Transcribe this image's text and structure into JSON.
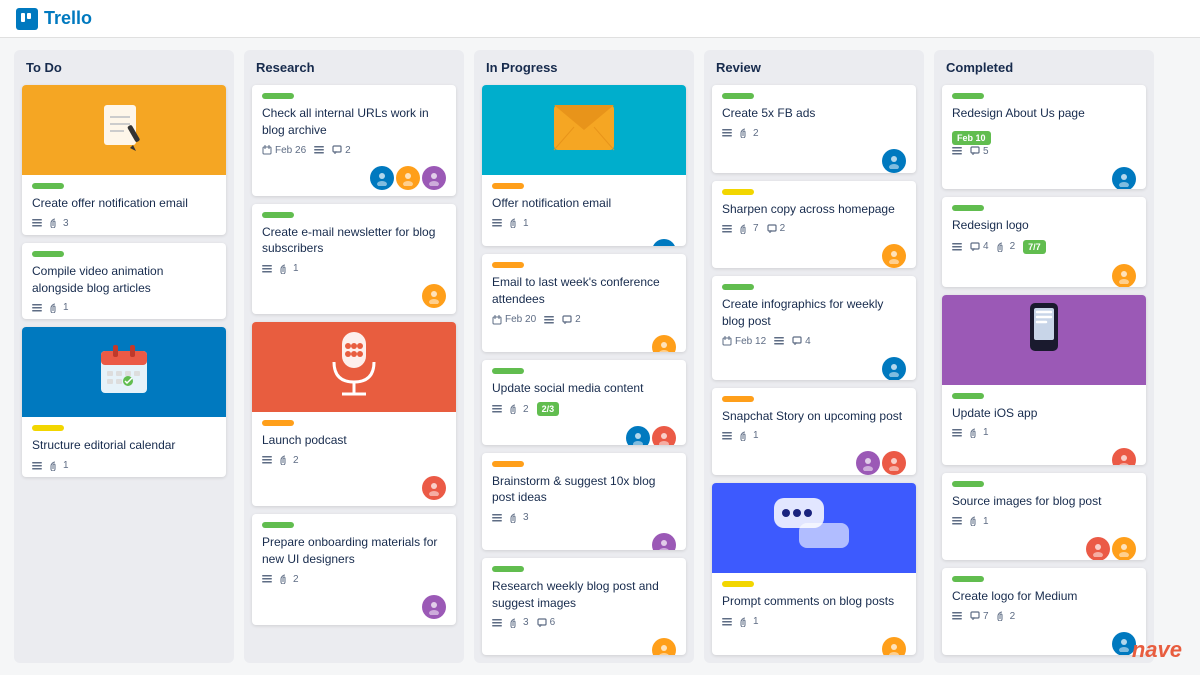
{
  "app": {
    "logo_text": "Trello",
    "nave_text": "nave"
  },
  "columns": [
    {
      "id": "todo",
      "title": "To Do",
      "cards": [
        {
          "id": "todo-1",
          "image_type": "yellow",
          "image_content": "note",
          "label_color": "green",
          "title": "Create offer notification email",
          "meta": [
            {
              "icon": "lines"
            },
            {
              "icon": "paperclip",
              "count": "3"
            }
          ],
          "avatars": []
        },
        {
          "id": "todo-2",
          "image_type": null,
          "image_content": null,
          "label_color": "green",
          "title": "Compile video animation alongside blog articles",
          "meta": [
            {
              "icon": "lines"
            },
            {
              "icon": "paperclip",
              "count": "1"
            }
          ],
          "avatars": []
        },
        {
          "id": "todo-3",
          "image_type": "blue",
          "image_content": "calendar",
          "label_color": "yellow",
          "title": "Structure editorial calendar",
          "meta": [
            {
              "icon": "lines"
            },
            {
              "icon": "paperclip",
              "count": "1"
            }
          ],
          "avatars": []
        }
      ]
    },
    {
      "id": "research",
      "title": "Research",
      "cards": [
        {
          "id": "research-1",
          "image_type": null,
          "image_content": null,
          "label_color": "green",
          "title": "Check all internal URLs work in blog archive",
          "meta": [
            {
              "icon": "date",
              "text": "Feb 26"
            },
            {
              "icon": "lines"
            },
            {
              "icon": "comment",
              "count": "2"
            }
          ],
          "avatars": [
            "blue",
            "orange",
            "purple"
          ]
        },
        {
          "id": "research-2",
          "image_type": null,
          "image_content": null,
          "label_color": "green",
          "title": "Create e-mail newsletter for blog subscribers",
          "meta": [
            {
              "icon": "lines"
            },
            {
              "icon": "paperclip",
              "count": "1"
            }
          ],
          "avatars": [
            "orange"
          ]
        },
        {
          "id": "research-3",
          "image_type": "orange",
          "image_content": "mic",
          "label_color": "orange",
          "title": "Launch podcast",
          "meta": [
            {
              "icon": "lines"
            },
            {
              "icon": "paperclip",
              "count": "2"
            }
          ],
          "avatars": [
            "red"
          ]
        },
        {
          "id": "research-4",
          "image_type": null,
          "image_content": null,
          "label_color": "green",
          "title": "Prepare onboarding materials for new UI designers",
          "meta": [
            {
              "icon": "lines"
            },
            {
              "icon": "paperclip",
              "count": "2"
            }
          ],
          "avatars": [
            "purple"
          ]
        }
      ]
    },
    {
      "id": "inprogress",
      "title": "In Progress",
      "cards": [
        {
          "id": "ip-1",
          "image_type": "green",
          "image_content": "envelope",
          "label_color": "orange",
          "title": "Offer notification email",
          "meta": [
            {
              "icon": "lines"
            },
            {
              "icon": "paperclip",
              "count": "1"
            }
          ],
          "avatars": [
            "blue"
          ]
        },
        {
          "id": "ip-2",
          "image_type": null,
          "image_content": null,
          "label_color": "orange",
          "title": "Email to last week's conference attendees",
          "meta": [
            {
              "icon": "date",
              "text": "Feb 20"
            },
            {
              "icon": "lines"
            },
            {
              "icon": "comment",
              "count": "2"
            }
          ],
          "avatars": [
            "orange"
          ]
        },
        {
          "id": "ip-3",
          "image_type": null,
          "image_content": null,
          "label_color": "green",
          "title": "Update social media content",
          "meta": [
            {
              "icon": "lines"
            },
            {
              "icon": "paperclip",
              "count": "2"
            },
            {
              "icon": "progress",
              "text": "2/3"
            }
          ],
          "avatars": [
            "blue",
            "red"
          ]
        },
        {
          "id": "ip-4",
          "image_type": null,
          "image_content": null,
          "label_color": "orange",
          "title": "Brainstorm & suggest 10x blog post ideas",
          "meta": [
            {
              "icon": "lines"
            },
            {
              "icon": "paperclip",
              "count": "3"
            }
          ],
          "avatars": [
            "purple"
          ]
        },
        {
          "id": "ip-5",
          "image_type": null,
          "image_content": null,
          "label_color": "green",
          "title": "Research weekly blog post and suggest images",
          "meta": [
            {
              "icon": "lines"
            },
            {
              "icon": "paperclip",
              "count": "3"
            },
            {
              "icon": "comment",
              "count": "6"
            }
          ],
          "avatars": [
            "orange"
          ]
        }
      ]
    },
    {
      "id": "review",
      "title": "Review",
      "cards": [
        {
          "id": "rev-1",
          "image_type": null,
          "image_content": null,
          "label_color": "green",
          "title": "Create 5x FB ads",
          "meta": [
            {
              "icon": "lines"
            },
            {
              "icon": "paperclip",
              "count": "2"
            }
          ],
          "avatars": [
            "blue"
          ]
        },
        {
          "id": "rev-2",
          "image_type": null,
          "image_content": null,
          "label_color": "yellow",
          "title": "Sharpen copy across homepage",
          "meta": [
            {
              "icon": "lines"
            },
            {
              "icon": "paperclip",
              "count": "7"
            },
            {
              "icon": "comment",
              "count": "2"
            }
          ],
          "avatars": [
            "orange"
          ]
        },
        {
          "id": "rev-3",
          "image_type": null,
          "image_content": null,
          "label_color": "green",
          "title": "Create infographics for weekly blog post",
          "meta": [
            {
              "icon": "date",
              "text": "Feb 12"
            },
            {
              "icon": "lines"
            },
            {
              "icon": "comment",
              "count": "4"
            }
          ],
          "avatars": [
            "blue"
          ]
        },
        {
          "id": "rev-4",
          "image_type": null,
          "image_content": null,
          "label_color": "orange",
          "title": "Snapchat Story on upcoming post",
          "meta": [
            {
              "icon": "lines"
            },
            {
              "icon": "paperclip",
              "count": "1"
            }
          ],
          "avatars": [
            "purple",
            "red"
          ]
        },
        {
          "id": "rev-5",
          "image_type": "blue2",
          "image_content": "chat",
          "label_color": "yellow",
          "title": "Prompt comments on blog posts",
          "meta": [
            {
              "icon": "lines"
            },
            {
              "icon": "paperclip",
              "count": "1"
            }
          ],
          "avatars": [
            "orange"
          ]
        }
      ]
    },
    {
      "id": "completed",
      "title": "Completed",
      "cards": [
        {
          "id": "comp-1",
          "image_type": null,
          "image_content": null,
          "label_color": "green",
          "title": "Redesign About Us page",
          "meta_date": "Feb 10",
          "meta": [
            {
              "icon": "lines"
            },
            {
              "icon": "comment",
              "count": "5"
            }
          ],
          "avatars": [
            "blue"
          ]
        },
        {
          "id": "comp-2",
          "image_type": null,
          "image_content": null,
          "label_color": "green",
          "title": "Redesign logo",
          "meta": [
            {
              "icon": "lines"
            },
            {
              "icon": "comment",
              "count": "4"
            },
            {
              "icon": "paperclip",
              "count": "2"
            },
            {
              "icon": "progress",
              "text": "7/7"
            }
          ],
          "avatars": [
            "orange"
          ]
        },
        {
          "id": "comp-3",
          "image_type": "purple",
          "image_content": "phone",
          "label_color": "green",
          "title": "Update iOS app",
          "meta": [
            {
              "icon": "lines"
            },
            {
              "icon": "paperclip",
              "count": "1"
            }
          ],
          "avatars": [
            "red"
          ]
        },
        {
          "id": "comp-4",
          "image_type": null,
          "image_content": null,
          "label_color": "green",
          "title": "Source images for blog post",
          "meta": [
            {
              "icon": "lines"
            },
            {
              "icon": "paperclip",
              "count": "1"
            }
          ],
          "avatars": [
            "red",
            "orange"
          ]
        },
        {
          "id": "comp-5",
          "image_type": null,
          "image_content": null,
          "label_color": "green",
          "title": "Create logo for Medium",
          "meta": [
            {
              "icon": "lines"
            },
            {
              "icon": "comment",
              "count": "7"
            },
            {
              "icon": "paperclip",
              "count": "2"
            }
          ],
          "avatars": [
            "blue"
          ]
        }
      ]
    }
  ]
}
